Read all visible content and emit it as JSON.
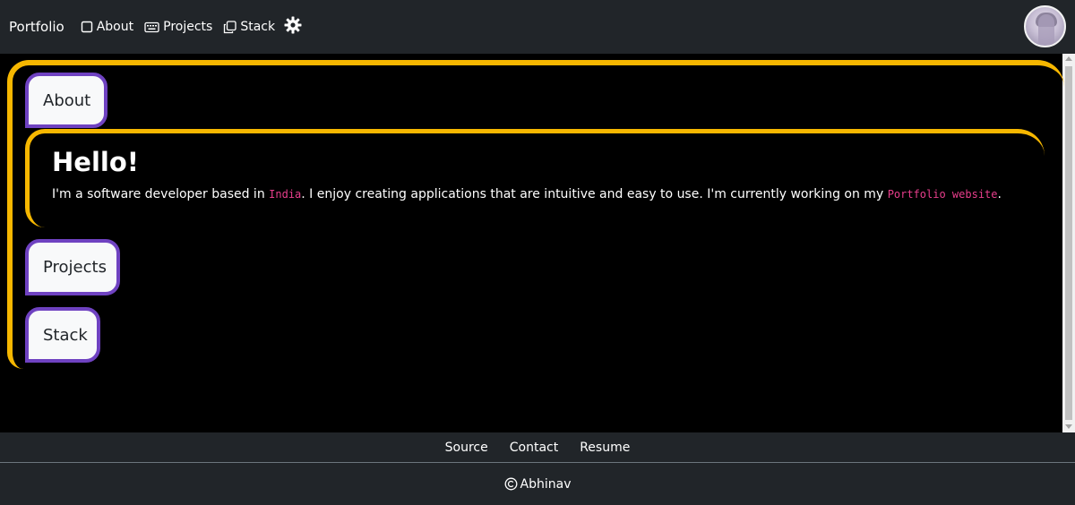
{
  "navbar": {
    "brand": "Portfolio",
    "links": [
      {
        "label": "About",
        "icon": "square-icon"
      },
      {
        "label": "Projects",
        "icon": "keyboard-icon"
      },
      {
        "label": "Stack",
        "icon": "stack-icon"
      }
    ],
    "theme_toggle_icon": "gear-icon",
    "avatar": "avatar"
  },
  "sections": {
    "about_label": "About",
    "projects_label": "Projects",
    "stack_label": "Stack"
  },
  "about": {
    "heading": "Hello!",
    "text_before": "I'm a software developer based in ",
    "location": "India",
    "text_middle": ". I enjoy creating applications that are intuitive and easy to use. I'm currently working on my ",
    "project": "Portfolio website",
    "text_after": "."
  },
  "footer": {
    "links": [
      "Source",
      "Contact",
      "Resume"
    ],
    "copyright_name": "Abhinav"
  },
  "colors": {
    "accent_yellow": "#f6b700",
    "accent_purple": "#6f42c1",
    "code_pink": "#e83e8c",
    "navbar_bg": "#212529"
  }
}
